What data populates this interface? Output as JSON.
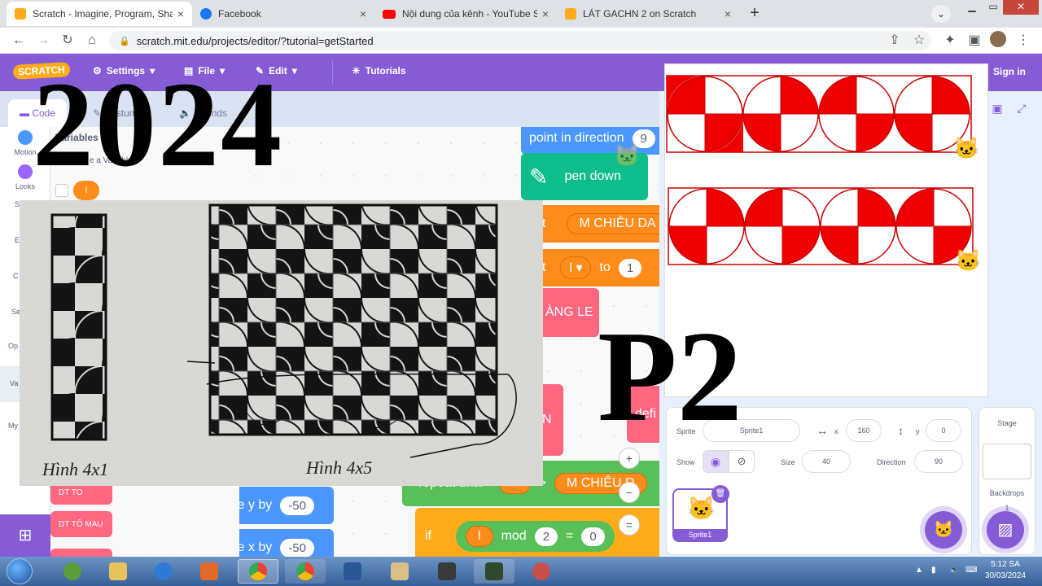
{
  "browser": {
    "tabs": [
      {
        "title": "Scratch - Imagine, Program, Shar",
        "favicon": "scratch-favicon-icon",
        "active": true
      },
      {
        "title": "Facebook",
        "favicon": "facebook-icon",
        "active": false
      },
      {
        "title": "Nội dung của kênh - YouTube Stu",
        "favicon": "youtube-icon",
        "active": false
      },
      {
        "title": "LÁT GACHN 2 on Scratch",
        "favicon": "scratch-favicon-icon",
        "active": false
      }
    ],
    "close_glyph": "×",
    "new_tab_glyph": "+",
    "url": "scratch.mit.edu/projects/editor/?tutorial=getStarted"
  },
  "scratch": {
    "logo": "SCRATCH",
    "menu": {
      "settings": "Settings",
      "file": "File",
      "edit": "Edit",
      "tutorials": "Tutorials",
      "sign_in": "Sign in"
    },
    "editor_tabs": {
      "code": "Code",
      "costumes": "Costumes",
      "sounds": "Sounds"
    },
    "categories": [
      {
        "label": "Motion",
        "color": "#4c97ff"
      },
      {
        "label": "Looks",
        "color": "#9966ff"
      },
      {
        "label": "S",
        "color": "#cf63cf"
      },
      {
        "label": "E",
        "color": "#ffbf00"
      },
      {
        "label": "C",
        "color": "#ffab19"
      },
      {
        "label": "Se",
        "color": "#5cb1d6"
      },
      {
        "label": "Op",
        "color": "#59c059"
      },
      {
        "label": "Va",
        "color": "#ff8c1a"
      },
      {
        "label": "My",
        "color": "#ff6680"
      }
    ],
    "palette": {
      "heading": "Variables",
      "make_var": "e a Variable",
      "var_name": "l",
      "block_dt_to": "DT TO",
      "block_dt_to_mau": "DT TÔ MAU",
      "change_y": "change y by",
      "change_y_val": "-50",
      "change_x": "change x by",
      "change_x_val": "-50"
    },
    "script": {
      "point_dir": "point in direction",
      "point_val": "9",
      "pen_down": "pen down",
      "set1_label": "t",
      "set1_val": "M CHIÊU DA",
      "set2_label": "t",
      "set2_var": "l ▾",
      "set2_to": "to",
      "set2_val": "1",
      "custom": "ÀNG LE",
      "define": "defi",
      "n_frag": "N",
      "repeat_until": "repeat until",
      "gt": ">",
      "cmp_right": "M CHIÊU D",
      "if_label": "if",
      "mod_var": "l",
      "mod_label": "mod",
      "mod_val": "2",
      "eq": "=",
      "eq_val": "0"
    },
    "sprite_info": {
      "sprite_label": "Sprite",
      "sprite_name": "Sprite1",
      "x_label": "x",
      "x_val": "160",
      "y_label": "y",
      "y_val": "0",
      "show_label": "Show",
      "size_label": "Size",
      "size_val": "40",
      "direction_label": "Direction",
      "direction_val": "90"
    },
    "sprite_tile_name": "Sprite1",
    "stage_panel": {
      "title": "Stage",
      "backdrops": "Backdrops",
      "count": "1"
    },
    "zoom": {
      "in": "+",
      "out": "−",
      "reset": "="
    }
  },
  "overlay": {
    "year": "2024",
    "part": "P2",
    "caption_left": "Hình 4x1",
    "caption_right": "Hình 4x5"
  },
  "taskbar": {
    "time": "5:12 SA",
    "date": "30/03/2024"
  },
  "colors": {
    "scratch_purple": "#855cd6",
    "tile_red": "#ee0000",
    "orange": "#ff8c1a",
    "pink": "#ff6680",
    "green": "#0fbd8c",
    "blue": "#4c97ff"
  }
}
